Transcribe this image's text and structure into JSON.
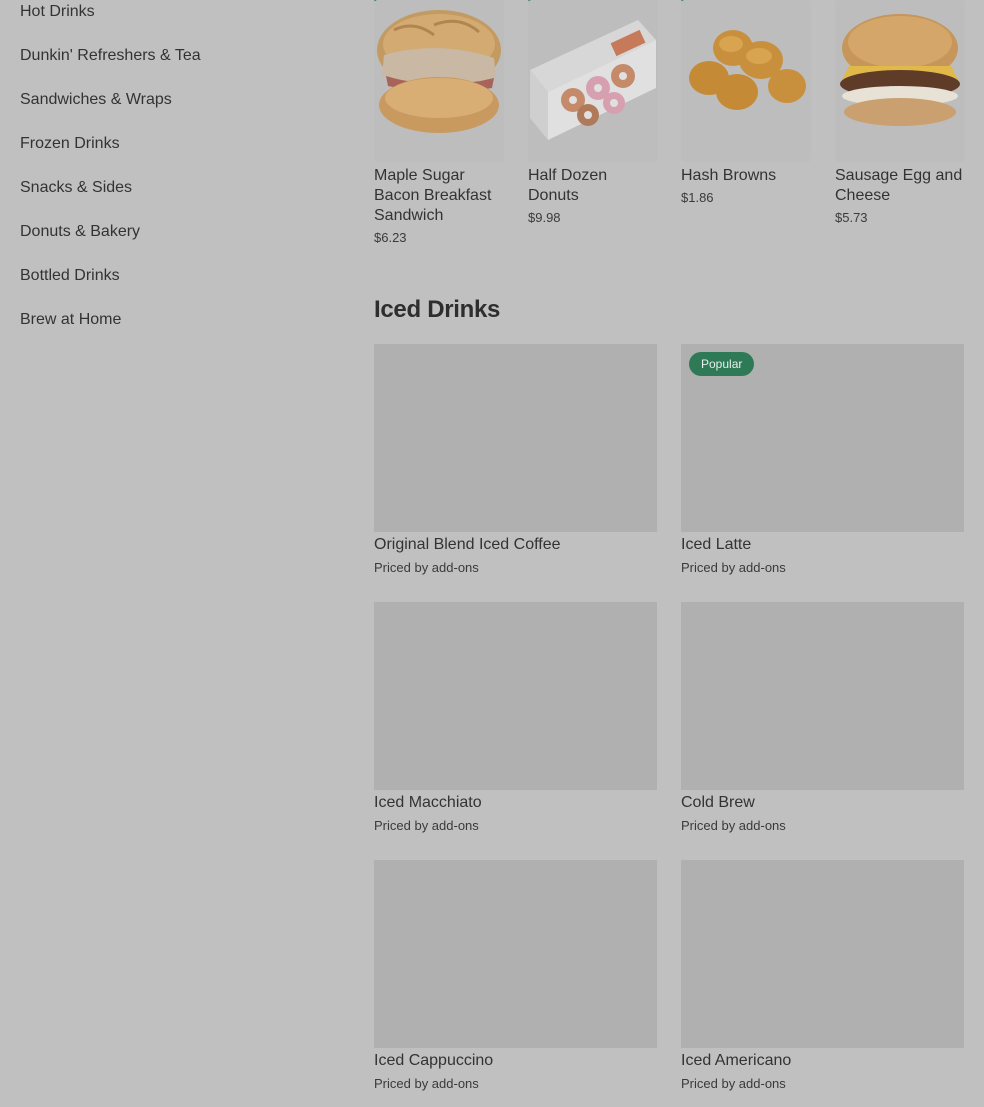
{
  "sidebar": {
    "items": [
      {
        "label": "Hot Drinks"
      },
      {
        "label": "Dunkin' Refreshers & Tea"
      },
      {
        "label": "Sandwiches & Wraps"
      },
      {
        "label": "Frozen Drinks"
      },
      {
        "label": "Snacks & Sides"
      },
      {
        "label": "Donuts & Bakery"
      },
      {
        "label": "Bottled Drinks"
      },
      {
        "label": "Brew at Home"
      }
    ]
  },
  "featured": [
    {
      "name": "Maple Sugar Bacon Breakfast Sandwich",
      "price": "$6.23",
      "icon": "sandwich-image"
    },
    {
      "name": "Half Dozen Donuts",
      "price": "$9.98",
      "icon": "donut-box-image"
    },
    {
      "name": "Hash Browns",
      "price": "$1.86",
      "icon": "hash-browns-image"
    },
    {
      "name": "Sausage Egg and Cheese",
      "price": "$5.73",
      "icon": "burger-image"
    }
  ],
  "iced_drinks": {
    "title": "Iced Drinks",
    "items": [
      {
        "name": "Original Blend Iced Coffee",
        "price": "Priced by add-ons",
        "badge": ""
      },
      {
        "name": "Iced Latte",
        "price": "Priced by add-ons",
        "badge": "Popular"
      },
      {
        "name": "Iced Macchiato",
        "price": "Priced by add-ons",
        "badge": ""
      },
      {
        "name": "Cold Brew",
        "price": "Priced by add-ons",
        "badge": ""
      },
      {
        "name": "Iced Cappuccino",
        "price": "Priced by add-ons",
        "badge": ""
      },
      {
        "name": "Iced Americano",
        "price": "Priced by add-ons",
        "badge": ""
      }
    ]
  },
  "colors": {
    "badge_green": "#2f7a56",
    "overlay_bg": "#c0c0c0"
  }
}
